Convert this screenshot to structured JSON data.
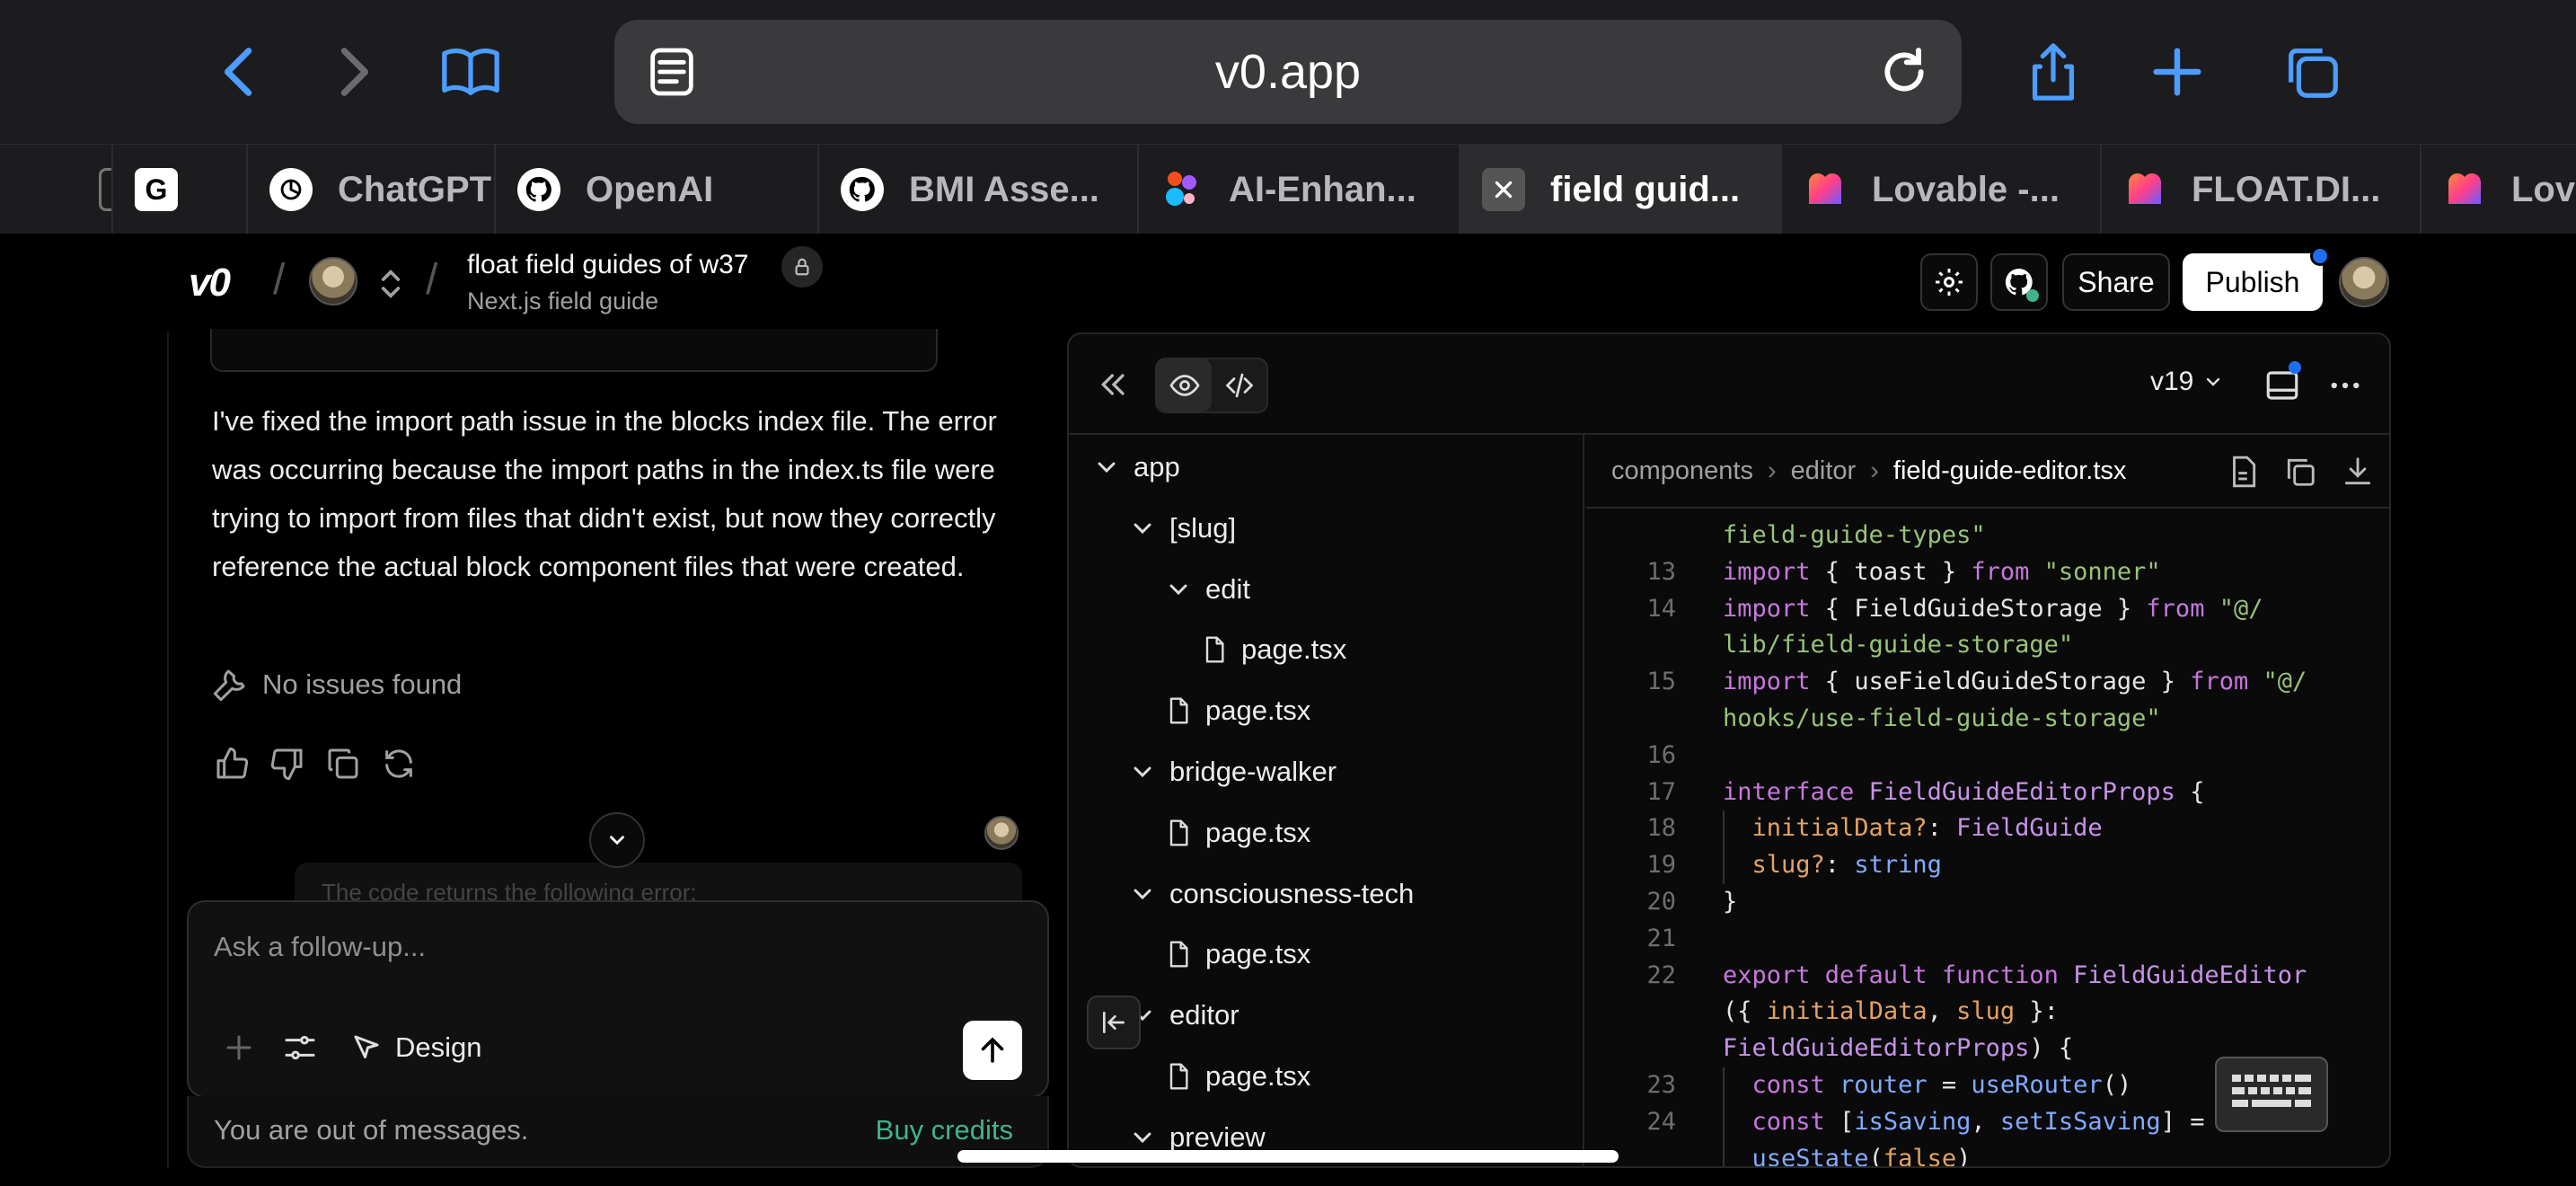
{
  "browser": {
    "url": "v0.app",
    "tabs": [
      {
        "label": "",
        "icon": "page-icon"
      },
      {
        "label": "",
        "icon": "g-icon"
      },
      {
        "label": "ChatGPT",
        "icon": "chatgpt-icon"
      },
      {
        "label": "OpenAI",
        "icon": "github-icon"
      },
      {
        "label": "BMI Asse...",
        "icon": "github-icon"
      },
      {
        "label": "AI-Enhan...",
        "icon": "figma-icon"
      },
      {
        "label": "field guid...",
        "icon": "close-icon",
        "active": true
      },
      {
        "label": "Lovable -...",
        "icon": "lovable-icon"
      },
      {
        "label": "FLOAT.DI...",
        "icon": "lovable-icon"
      },
      {
        "label": "Lova",
        "icon": "lovable-icon"
      }
    ]
  },
  "header": {
    "logo": "v0",
    "project_title": "float field guides of w37",
    "project_subtitle": "Next.js field guide",
    "share_label": "Share",
    "publish_label": "Publish"
  },
  "chat": {
    "message": "I've fixed the import path issue in the blocks index file. The error was occurring because the import paths in the index.ts file were trying to import from files that didn't exist, but now they correctly reference the actual block component files that were created.",
    "issues_label": "No issues found",
    "faded_message": "The code returns the following error:",
    "composer_placeholder": "Ask a follow-up...",
    "design_label": "Design",
    "out_of_messages": "You are out of messages.",
    "buy_credits": "Buy credits"
  },
  "panel": {
    "version": "v19",
    "tree": [
      {
        "label": "app",
        "type": "folder",
        "depth": 0
      },
      {
        "label": "[slug]",
        "type": "folder",
        "depth": 1
      },
      {
        "label": "edit",
        "type": "folder",
        "depth": 2
      },
      {
        "label": "page.tsx",
        "type": "file",
        "depth": 3
      },
      {
        "label": "page.tsx",
        "type": "file",
        "depth": 2
      },
      {
        "label": "bridge-walker",
        "type": "folder",
        "depth": 1
      },
      {
        "label": "page.tsx",
        "type": "file",
        "depth": 2
      },
      {
        "label": "consciousness-tech",
        "type": "folder",
        "depth": 1
      },
      {
        "label": "page.tsx",
        "type": "file",
        "depth": 2
      },
      {
        "label": "editor",
        "type": "folder",
        "depth": 1
      },
      {
        "label": "page.tsx",
        "type": "file",
        "depth": 2
      },
      {
        "label": "preview",
        "type": "folder",
        "depth": 1
      }
    ],
    "breadcrumb": [
      "components",
      "editor",
      "field-guide-editor.tsx"
    ],
    "code_lines": [
      {
        "n": "",
        "html": "<span class='s2'>field-guide-types\"</span>"
      },
      {
        "n": "13",
        "html": "<span class='k'>import</span><span class='t'> { toast } </span><span class='k'>from</span><span class='s2'> \"sonner\"</span>"
      },
      {
        "n": "14",
        "html": "<span class='k'>import</span><span class='t'> { FieldGuideStorage } </span><span class='k'>from</span><span class='s2'> \"@/</span>"
      },
      {
        "n": "",
        "html": "<span class='s2'>lib/field-guide-storage\"</span>"
      },
      {
        "n": "15",
        "html": "<span class='k'>import</span><span class='t'> { useFieldGuideStorage } </span><span class='k'>from</span><span class='s2'> \"@/</span>"
      },
      {
        "n": "",
        "html": "<span class='s2'>hooks/use-field-guide-storage\"</span>"
      },
      {
        "n": "16",
        "html": ""
      },
      {
        "n": "17",
        "html": "<span class='k'>interface</span><span class='ty'> FieldGuideEditorProps</span><span class='t'> {</span>"
      },
      {
        "n": "18",
        "html": "<span class='pr'>  initialData?</span><span class='t'>: </span><span class='ty'>FieldGuide</span>"
      },
      {
        "n": "19",
        "html": "<span class='pr'>  slug?</span><span class='t'>: </span><span class='bl'>string</span>"
      },
      {
        "n": "20",
        "html": "<span class='t'>}</span>"
      },
      {
        "n": "21",
        "html": ""
      },
      {
        "n": "22",
        "html": "<span class='k'>export default function</span><span class='ty'> FieldGuideEditor</span>"
      },
      {
        "n": "",
        "html": "<span class='t'>({ </span><span class='pr'>initialData</span><span class='t'>, </span><span class='pr'>slug</span><span class='t'> }:</span>"
      },
      {
        "n": "",
        "html": "<span class='ty'>FieldGuideEditorProps</span><span class='t'>) {</span>"
      },
      {
        "n": "23",
        "html": "<span class='k'>  const</span><span class='bl'> router</span><span class='t'> = </span><span class='bl'>useRouter</span><span class='t'>()</span>"
      },
      {
        "n": "24",
        "html": "<span class='k'>  const</span><span class='t'> [</span><span class='bl'>isSaving</span><span class='t'>, </span><span class='bl'>setIsSaving</span><span class='t'>] =</span>"
      },
      {
        "n": "",
        "html": "<span class='bl'>  useState</span><span class='t'>(</span><span class='pr'>false</span><span class='t'>)</span>"
      }
    ]
  },
  "colors": {
    "accent_green": "#3fb48a",
    "publish_dot": "#1d6ef5",
    "safari_blue": "#4d9cff"
  }
}
